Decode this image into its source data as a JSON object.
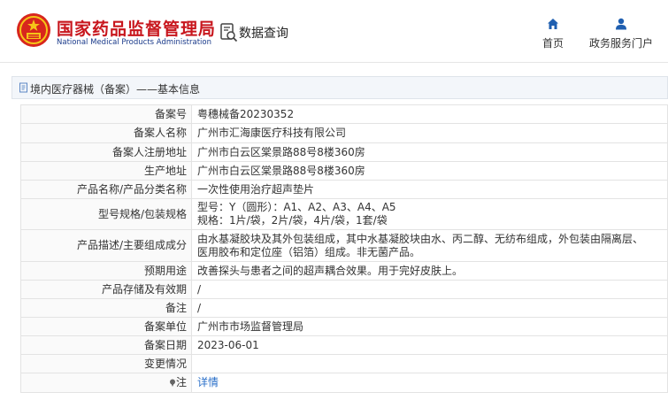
{
  "header": {
    "title": "国家药品监督管理局",
    "subtitle": "National Medical Products Administration",
    "query_label": "数据查询",
    "nav": {
      "home": "首页",
      "services": "政务服务门户"
    }
  },
  "breadcrumb": {
    "text": "境内医疗器械（备案）——基本信息"
  },
  "record": {
    "rows": [
      {
        "label": "备案号",
        "value": "粤穗械备20230352"
      },
      {
        "label": "备案人名称",
        "value": "广州市汇海康医疗科技有限公司"
      },
      {
        "label": "备案人注册地址",
        "value": "广州市白云区棠景路88号8楼360房"
      },
      {
        "label": "生产地址",
        "value": "广州市白云区棠景路88号8楼360房"
      },
      {
        "label": "产品名称/产品分类名称",
        "value": "一次性使用治疗超声垫片"
      },
      {
        "label": "型号规格/包装规格",
        "value_line1": "型号：Y（圆形）：A1、A2、A3、A4、A5",
        "value_line2": "规格：1片/袋，2片/袋，4片/袋，1套/袋"
      },
      {
        "label": "产品描述/主要组成成分",
        "value_line1": "由水基凝胶块及其外包装组成，其中水基凝胶块由水、丙二醇、无纺布组成，外包装由隔离层、",
        "value_line2": "医用胶布和定位座（铝箔）组成。非无菌产品。"
      },
      {
        "label": "预期用途",
        "value": "改善探头与患者之间的超声耦合效果。用于完好皮肤上。"
      },
      {
        "label": "产品存储及有效期",
        "value": "/"
      },
      {
        "label": "备注",
        "value": "/"
      },
      {
        "label": "备案单位",
        "value": "广州市市场监督管理局"
      },
      {
        "label": "备案日期",
        "value": "2023-06-01"
      },
      {
        "label": "变更情况",
        "value": ""
      },
      {
        "label": "注",
        "value": "详情"
      }
    ]
  },
  "colors": {
    "brand_red": "#c8161d",
    "brand_blue": "#1a3a8a",
    "nav_blue": "#1f5fb0",
    "link_blue": "#2a6fc9"
  },
  "icons": {
    "emblem": "national-emblem-icon",
    "query": "search-document-icon",
    "home": "home-icon",
    "user": "user-icon",
    "breadcrumb": "document-icon",
    "note": "pin-icon"
  }
}
